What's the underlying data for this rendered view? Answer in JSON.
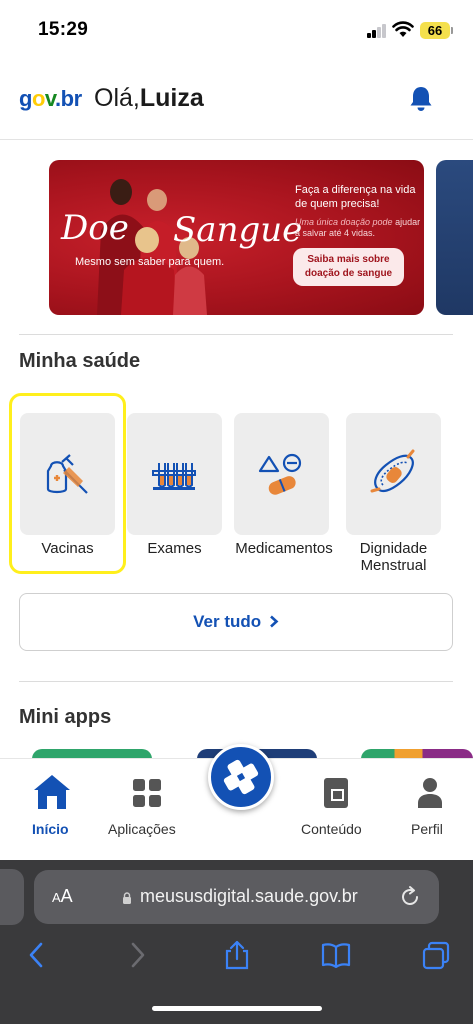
{
  "status_bar": {
    "time": "15:29",
    "battery": "66"
  },
  "header": {
    "logo": {
      "g": "g",
      "o": "o",
      "v": "v",
      "dot": ".",
      "b": "b",
      "r": "r"
    },
    "greeting_prefix": "Olá,",
    "user_name": "Luiza"
  },
  "banner": {
    "title_left": "Doe",
    "title_right": "Sangue",
    "tagline": "Mesmo sem saber para quem.",
    "headline": "Faça a diferença na vida de quem precisa!",
    "sub_italic": "Uma única doação pode",
    "sub_rest": "ajudar a salvar até 4 vidas.",
    "cta": "Saiba mais sobre doação de sangue"
  },
  "minha_saude": {
    "title": "Minha saúde",
    "items": [
      {
        "label": "Vacinas",
        "icon": "vaccine-icon"
      },
      {
        "label": "Exames",
        "icon": "test-tubes-icon"
      },
      {
        "label": "Medicamentos",
        "icon": "medicine-shapes-icon"
      },
      {
        "label": "Dignidade Menstrual",
        "icon": "pad-icon"
      }
    ],
    "ver_tudo": "Ver tudo"
  },
  "mini_apps": {
    "title": "Mini apps"
  },
  "bottom_nav": {
    "inicio": "Início",
    "aplicacoes": "Aplicações",
    "conteudo": "Conteúdo",
    "perfil": "Perfil"
  },
  "browser": {
    "aa_large": "A",
    "aa_small": "A",
    "url": "meusus​digital.saude.gov.br"
  },
  "colors": {
    "brand_blue": "#1351b4",
    "highlight_yellow": "#ffef1c",
    "banner_red": "#b31822"
  }
}
